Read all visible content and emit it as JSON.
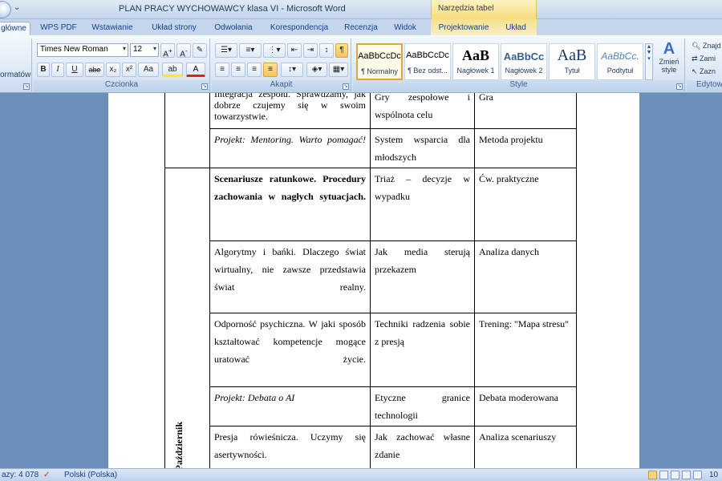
{
  "window": {
    "title": "PLAN PRACY WYCHOWAWCY klasa VI - Microsoft Word",
    "context_group": "Narzędzia tabel",
    "quick_access": "⌄"
  },
  "tabs": [
    "główne",
    "WPS PDF",
    "Wstawianie",
    "Układ strony",
    "Odwołania",
    "Korespondencja",
    "Recenzja",
    "Widok",
    "Projektowanie",
    "Układ"
  ],
  "ribbon": {
    "clipboard_fragment": "ormatów",
    "font_group_label": "Czcionka",
    "paragraph_group_label": "Akapit",
    "styles_group_label": "Style",
    "editing_group_label": "Edytow",
    "font_name": "Times New Roman",
    "font_size": "12",
    "font_buttons": [
      "B",
      "I",
      "U",
      "abe",
      "x₂",
      "x²",
      "Aa"
    ],
    "styles": [
      {
        "sample": "AaBbCcDc",
        "name": "¶ Normalny"
      },
      {
        "sample": "AaBbCcDc",
        "name": "¶ Bez odst..."
      },
      {
        "sample": "AaB",
        "name": "Nagłówek 1"
      },
      {
        "sample": "AaBbCc",
        "name": "Nagłówek 2"
      },
      {
        "sample": "AaB",
        "name": "Tytuł"
      },
      {
        "sample": "AaBbCc.",
        "name": "Podtytuł"
      }
    ],
    "change_styles": "Zmień style",
    "editing_items": [
      "Znajd",
      "Zami",
      "Zazn"
    ]
  },
  "table": {
    "month_label": "Październik",
    "rows": [
      {
        "topic": "Integracja zespołu. Sprawdzamy, jak dobrze czujemy się w swoim towarzystwie.",
        "skill": "Gry zespołowe i wspólnota celu",
        "method": "Gra"
      },
      {
        "topic": "Projekt: Mentoring. Warto pomagać!",
        "skill": "System wsparcia dla młodszych",
        "method": "Metoda projektu"
      },
      {
        "topic": "Scenariusze ratunkowe. Procedury zachowania w nagłych sytuacjach.",
        "skill": "Triaż – decyzje w wypadku",
        "method": "Ćw. praktyczne"
      },
      {
        "topic": "Algorytmy i bańki. Dlaczego świat wirtualny, nie zawsze przedstawia świat realny.",
        "skill": "Jak media sterują przekazem",
        "method": "Analiza danych"
      },
      {
        "topic": "Odporność psychiczna. W jaki sposób kształtować kompetencje mogące uratować życie.",
        "skill": "Techniki radzenia sobie z presją",
        "method": "Trening: \"Mapa stresu\""
      },
      {
        "topic": "Projekt: Debata o AI",
        "skill": "Etyczne granice technologii",
        "method": "Debata moderowana"
      },
      {
        "topic": "Presja rówieśnicza. Uczymy się asertywności.",
        "skill": "Jak zachować własne zdanie",
        "method": "Analiza scenariuszy"
      }
    ]
  },
  "status": {
    "words": "azy: 4 078",
    "language": "Polski (Polska)",
    "zoom_fragment": "10"
  }
}
